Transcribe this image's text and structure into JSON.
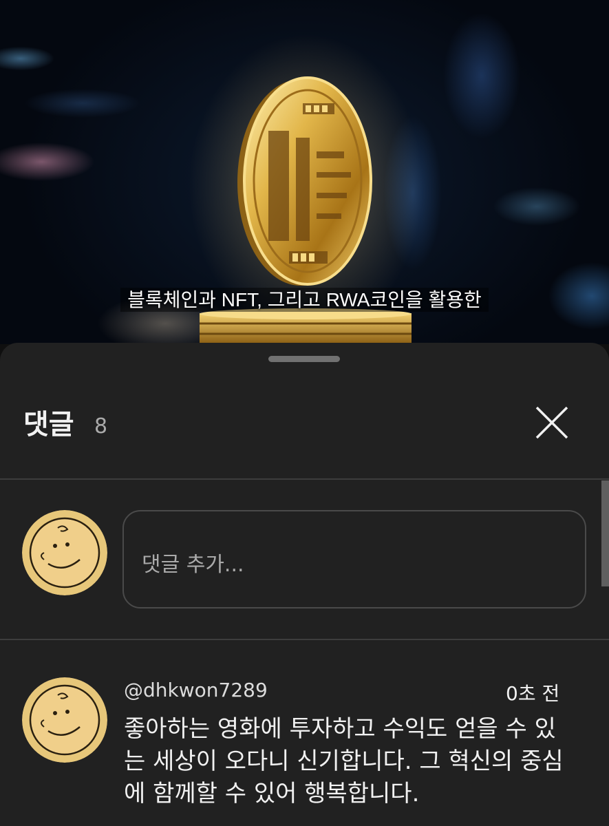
{
  "video": {
    "subtitle": "블록체인과 NFT, 그리고 RWA코인을 활용한"
  },
  "comments_panel": {
    "title": "댓글",
    "count": "8",
    "close_icon": "close-icon",
    "add_comment_placeholder": "댓글 추가...",
    "comments": [
      {
        "author": "@dhkwon7289",
        "time": "0초 전",
        "text_lines": [
          "좋아하는 영화에 투자하고 수익도 얻을 수 있",
          "는 세상이 오다니 신기합니다. 그 혁신의 중심",
          "에 함께할 수 있어 행복합니다."
        ]
      }
    ]
  },
  "colors": {
    "sheet_bg": "#212121",
    "page_bg": "#0f0f0f",
    "text": "#f1f1f1",
    "muted": "#aaaaaa",
    "gold": "#d8b04a"
  }
}
